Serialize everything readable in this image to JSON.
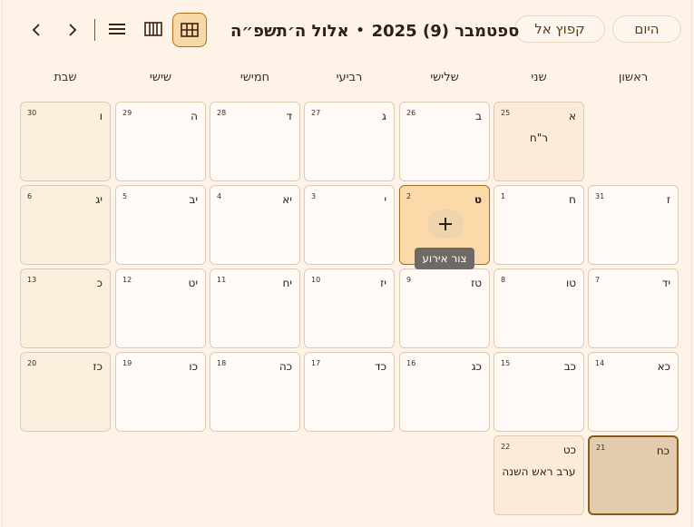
{
  "header": {
    "today_label": "היום",
    "jump_label": "קפוץ אל",
    "title_hebrew": "אלול ה׳תשפ״ה",
    "title_dot": "•",
    "title_gregorian": "ספטמבר (9) 2025"
  },
  "weekdays": [
    "ראשון",
    "שני",
    "שלישי",
    "רביעי",
    "חמישי",
    "שישי",
    "שבת"
  ],
  "weeks": [
    [
      null,
      {
        "heb": "א",
        "greg": "25",
        "note": "ר\"ח",
        "type": "rh"
      },
      {
        "heb": "ב",
        "greg": "26"
      },
      {
        "heb": "ג",
        "greg": "27"
      },
      {
        "heb": "ד",
        "greg": "28"
      },
      {
        "heb": "ה",
        "greg": "29"
      },
      {
        "heb": "ו",
        "greg": "30",
        "type": "shabbat"
      }
    ],
    [
      {
        "heb": "ז",
        "greg": "31"
      },
      {
        "heb": "ח",
        "greg": "1"
      },
      {
        "heb": "ט",
        "greg": "2",
        "type": "today"
      },
      {
        "heb": "י",
        "greg": "3"
      },
      {
        "heb": "יא",
        "greg": "4"
      },
      {
        "heb": "יב",
        "greg": "5"
      },
      {
        "heb": "יג",
        "greg": "6",
        "type": "shabbat"
      }
    ],
    [
      {
        "heb": "יד",
        "greg": "7"
      },
      {
        "heb": "טו",
        "greg": "8"
      },
      {
        "heb": "טז",
        "greg": "9"
      },
      {
        "heb": "יז",
        "greg": "10"
      },
      {
        "heb": "יח",
        "greg": "11"
      },
      {
        "heb": "יט",
        "greg": "12"
      },
      {
        "heb": "כ",
        "greg": "13",
        "type": "shabbat"
      }
    ],
    [
      {
        "heb": "כא",
        "greg": "14"
      },
      {
        "heb": "כב",
        "greg": "15"
      },
      {
        "heb": "כג",
        "greg": "16"
      },
      {
        "heb": "כד",
        "greg": "17"
      },
      {
        "heb": "כה",
        "greg": "18"
      },
      {
        "heb": "כו",
        "greg": "19"
      },
      {
        "heb": "כז",
        "greg": "20",
        "type": "shabbat"
      }
    ],
    [
      {
        "heb": "כח",
        "greg": "21",
        "type": "selected"
      },
      {
        "heb": "כט",
        "greg": "22",
        "note": "ערב ראש השנה",
        "type": "erev"
      },
      null,
      null,
      null,
      null,
      null
    ]
  ],
  "tooltip": "צור אירוע",
  "colors": {
    "background": "#fff3e8",
    "accent": "#b0701e",
    "today": "#fcd9a8",
    "selected": "#e3ccae",
    "shabbat": "#fceedd"
  }
}
